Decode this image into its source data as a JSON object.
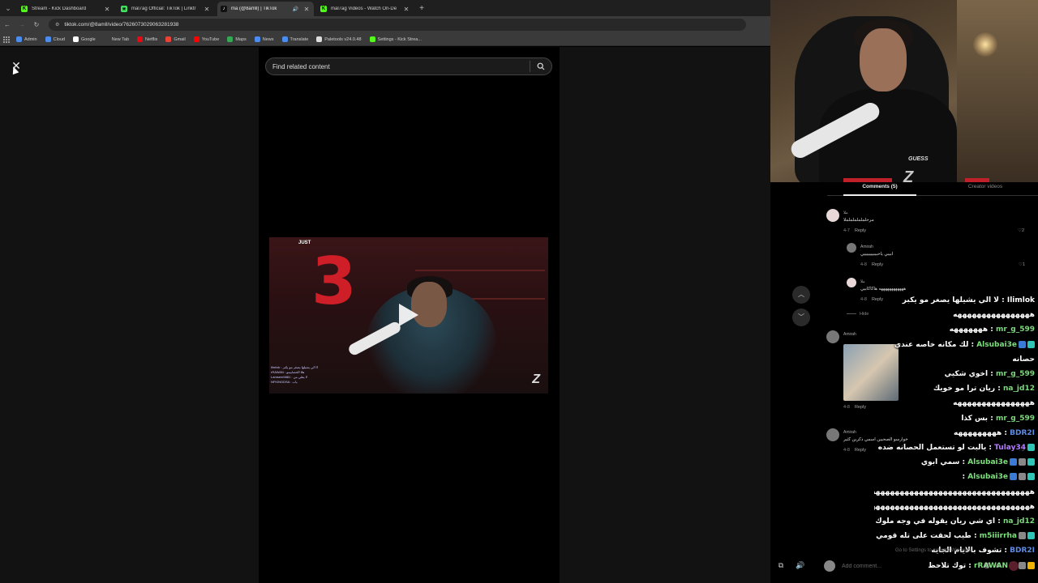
{
  "browser": {
    "tabs": [
      {
        "title": "Stream - Kick Dashboard",
        "favicon_color": "#53fc18",
        "favicon_letter": "K",
        "active": false
      },
      {
        "title": "mal7ag Official: TikTok | Linktr",
        "favicon_color": "#43e660",
        "favicon_letter": "✳",
        "active": false
      },
      {
        "title": "ma (@8amll) | TikTok",
        "favicon_color": "#111111",
        "favicon_letter": "♪",
        "active": true
      },
      {
        "title": "mal7ag Videos - Watch On-De",
        "favicon_color": "#53fc18",
        "favicon_letter": "K",
        "active": false
      }
    ],
    "url": "tiktok.com/@8amll/video/7626073029063281938",
    "bookmarks": [
      {
        "label": "Admin",
        "color": "#4a8cf0"
      },
      {
        "label": "Cloud",
        "color": "#4a8cf0"
      },
      {
        "label": "Google",
        "color": "#ffffff"
      },
      {
        "label": "New Tab",
        "color": "#3a3a3a"
      },
      {
        "label": "Netflix",
        "color": "#e50914"
      },
      {
        "label": "Gmail",
        "color": "#ea4335"
      },
      {
        "label": "YouTube",
        "color": "#ff0000"
      },
      {
        "label": "Maps",
        "color": "#34a853"
      },
      {
        "label": "News",
        "color": "#4a8cf0"
      },
      {
        "label": "Translate",
        "color": "#4a8cf0"
      },
      {
        "label": "Paletools v24.0.48",
        "color": "#dddddd"
      },
      {
        "label": "Settings - Kick Strea...",
        "color": "#53fc18"
      }
    ]
  },
  "tiktok": {
    "search_placeholder": "Find related content",
    "thumb_tag": "JUST",
    "thumb_watermark": "Z",
    "thumb_chat": [
      "Ilimlok : لا الي يشيلها يصغر مو يكبر",
      "rRAWAN : هلا الحصابيمو",
      "Lamsem5881 : لا يطي من",
      "NFKINGDSA : ياب"
    ],
    "comments_tab": "Comments (5)",
    "creator_tab": "Creator videos",
    "comments": [
      {
        "name": "ملا",
        "text": "مرحلملململململا",
        "date": "4-7",
        "reply": "Reply",
        "likes": "2"
      },
      {
        "name": "Amirah",
        "text": "ابيبي ياحبيبيييييييي",
        "date": "4-8",
        "reply": "Reply",
        "likes": "1"
      },
      {
        "name": "ملا",
        "text": "ههههههههههههه هاكاكابيي",
        "date": "4-8",
        "reply": "Reply",
        "likes": "1"
      },
      {
        "name": "Amirah",
        "text": "",
        "date": "4-8",
        "reply": "Reply",
        "likes": "0"
      },
      {
        "name": "Amirah",
        "text": "خوارسو الصحيين اسمي ذكرين كثير",
        "date": "4-8",
        "reply": "Reply",
        "likes": "0"
      }
    ],
    "hide_label": "Hide",
    "add_comment_placeholder": "Add comment...",
    "activate_windows": "Go to Settings to activate Windows."
  },
  "stream": {
    "cam_brand": "GUESS",
    "cam_logo": "Z",
    "chat": [
      {
        "user": "Ilimlok",
        "msg": "لا الي يشيلها يصغر مو يكبر",
        "color": "#ffffff",
        "badges": []
      },
      {
        "user": "",
        "msg": "ههههههههههههههههه",
        "color": "#ffffff",
        "badges": []
      },
      {
        "user": "mr_g_599",
        "msg": "هههههههه",
        "color": "#7dd87d",
        "badges": []
      },
      {
        "user": "Alsubai3e",
        "msg": "لك مكانه خاصه عندي",
        "color": "#7de07d",
        "badges": [
          "#3a7bd5",
          "#2ec4b6"
        ]
      },
      {
        "user": "",
        "msg": "حصانه",
        "color": "#ffffff",
        "badges": []
      },
      {
        "user": "mr_g_599",
        "msg": "اخوي شكيي",
        "color": "#7dd87d",
        "badges": []
      },
      {
        "user": "na_jd12",
        "msg": "ريان ترا مو خويك",
        "color": "#7dd87d",
        "badges": []
      },
      {
        "user": "",
        "msg": "ههههههههههههههههه",
        "color": "#ffffff",
        "badges": []
      },
      {
        "user": "mr_g_599",
        "msg": "بس كذا",
        "color": "#7dd87d",
        "badges": []
      },
      {
        "user": "BDR2I",
        "msg": "هههههههههه",
        "color": "#5c8ce6",
        "badges": []
      },
      {
        "user": "Tulay34",
        "msg": "يالبت لو تستعمل الحصانه ضده",
        "color": "#b37dff",
        "badges": [
          "#2ec4b6"
        ]
      },
      {
        "user": "Alsubai3e",
        "msg": "سمي ابوي",
        "color": "#7de07d",
        "badges": [
          "#3a7bd5",
          "#888888",
          "#2ec4b6"
        ]
      },
      {
        "user": "Alsubai3e",
        "msg": "",
        "color": "#7de07d",
        "badges": [
          "#3a7bd5",
          "#888888",
          "#2ec4b6"
        ]
      },
      {
        "user": "",
        "msg": "هههههههههههههههههههههههههههههههههه",
        "color": "#ffffff",
        "badges": []
      },
      {
        "user": "",
        "msg": "ههههههههههههههههههههههههههههههههههه",
        "color": "#ffffff",
        "badges": []
      },
      {
        "user": "na_jd12",
        "msg": "اي شي ريان يقوله في وجه ملوك",
        "color": "#7dd87d",
        "badges": []
      },
      {
        "user": "m5iiirrha",
        "msg": "طيب لحقت على تله قومي قومي؟",
        "color": "#7de07d",
        "badges": [
          "#888888",
          "#2ec4b6"
        ]
      },
      {
        "user": "BDR2I",
        "msg": "تشوف بالايام الجايه",
        "color": "#5c8ce6",
        "badges": []
      },
      {
        "user": "rRAWAN",
        "msg": "توك تلاحظ",
        "color": "#7de07d",
        "badges": [
          "#3a7bd5",
          "#888888",
          "#f0b400"
        ]
      }
    ]
  }
}
